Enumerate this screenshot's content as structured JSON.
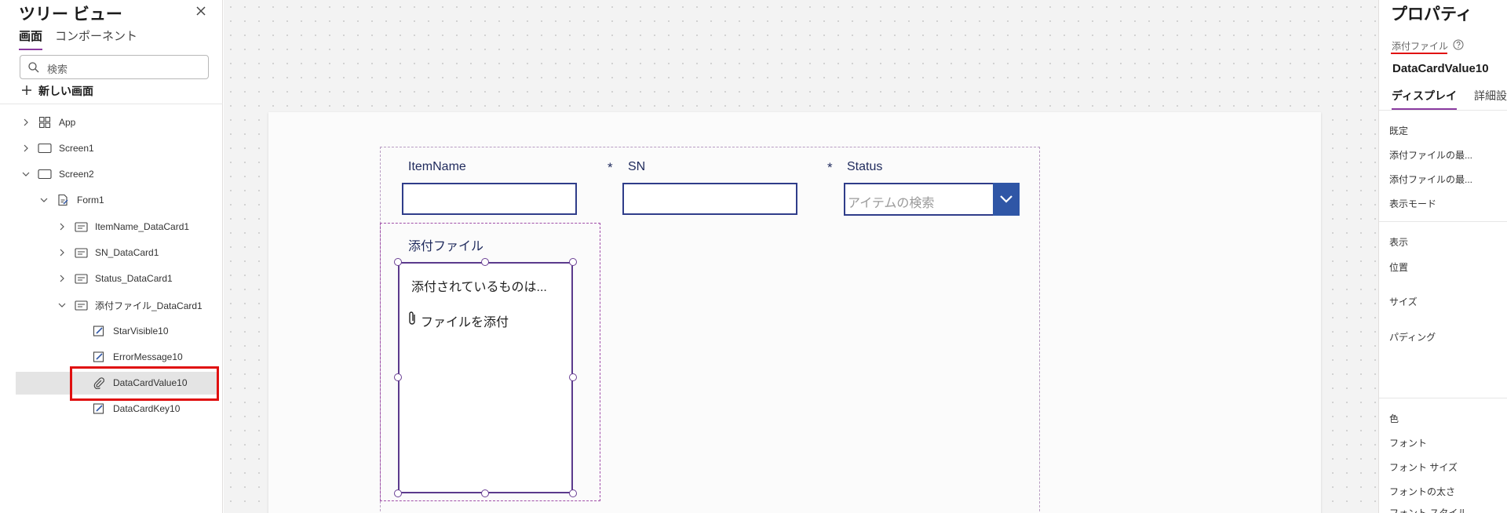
{
  "tree": {
    "title": "ツリー ビュー",
    "tabs": [
      {
        "label": "画面",
        "active": true
      },
      {
        "label": "コンポーネント",
        "active": false
      }
    ],
    "search_placeholder": "検索",
    "new_screen_label": "新しい画面",
    "items": [
      {
        "label": "App",
        "icon": "app-grid-icon",
        "chevron": "right"
      },
      {
        "label": "Screen1",
        "icon": "screen-icon",
        "chevron": "right"
      },
      {
        "label": "Screen2",
        "icon": "screen-icon",
        "chevron": "down"
      },
      {
        "label": "Form1",
        "icon": "form-icon",
        "chevron": "down"
      },
      {
        "label": "ItemName_DataCard1",
        "icon": "datacard-icon",
        "chevron": "right"
      },
      {
        "label": "SN_DataCard1",
        "icon": "datacard-icon",
        "chevron": "right"
      },
      {
        "label": "Status_DataCard1",
        "icon": "datacard-icon",
        "chevron": "right"
      },
      {
        "label": "添付ファイル_DataCard1",
        "icon": "datacard-icon",
        "chevron": "down"
      },
      {
        "label": "StarVisible10",
        "icon": "label-edit-icon",
        "chevron": "none"
      },
      {
        "label": "ErrorMessage10",
        "icon": "label-edit-icon",
        "chevron": "none"
      },
      {
        "label": "DataCardValue10",
        "icon": "paperclip-icon",
        "chevron": "none",
        "selected": true
      },
      {
        "label": "DataCardKey10",
        "icon": "label-edit-icon",
        "chevron": "none"
      }
    ]
  },
  "form": {
    "itemname_label": "ItemName",
    "sn_star": "*",
    "sn_label": "SN",
    "status_star": "*",
    "status_label": "Status",
    "status_placeholder": "アイテムの検索",
    "attach_label": "添付ファイル",
    "attach_message": "添付されているものは...",
    "attach_add": "ファイルを添付"
  },
  "props": {
    "title": "プロパティ",
    "control_type": "添付ファイル",
    "control_name": "DataCardValue10",
    "tabs": [
      {
        "label": "ディスプレイ",
        "active": true
      },
      {
        "label": "詳細設定",
        "active": false
      }
    ],
    "groups": {
      "g1": [
        "既定",
        "添付ファイルの最...",
        "添付ファイルの最...",
        "表示モード"
      ],
      "g2": [
        "表示",
        "位置",
        "サイズ",
        "パディング"
      ],
      "g3": [
        "色",
        "フォント",
        "フォント サイズ",
        "フォントの太さ",
        "フォント スタイル"
      ]
    }
  },
  "colors": {
    "accent_purple": "#8a3aa0",
    "input_border": "#2f3d8a",
    "dropdown_button": "#2f56a6",
    "highlight_red": "#e01010"
  }
}
